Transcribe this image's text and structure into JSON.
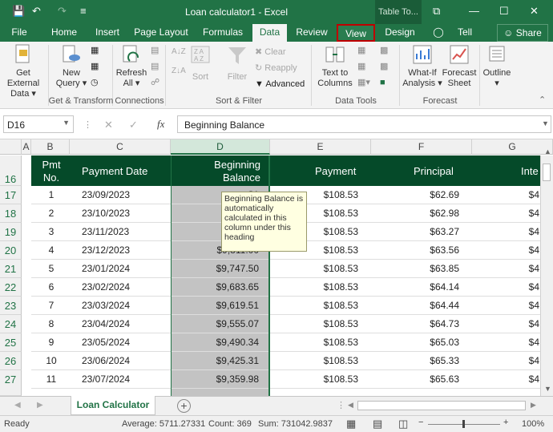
{
  "titlebar": {
    "save_icon": "💾",
    "undo_icon": "↶",
    "redo_icon": "↷",
    "more_icon": "≡",
    "title": "Loan calculator1 - Excel",
    "table_tools": "Table To...",
    "restore_icon": "⧉",
    "minimize_icon": "—",
    "maximize_icon": "☐",
    "close_icon": "✕"
  },
  "ribbon_tabs": [
    "File",
    "Home",
    "Insert",
    "Page Layout",
    "Formulas",
    "Data",
    "Review",
    "View",
    "Design"
  ],
  "active_tab": "Data",
  "tell_me": "Tell me...",
  "share": "Share",
  "ribbon": {
    "get_external_data": [
      "Get External",
      "Data ▾"
    ],
    "new_query": [
      "New",
      "Query ▾"
    ],
    "refresh_all": [
      "Refresh",
      "All ▾"
    ],
    "sort": "Sort",
    "filter": "Filter",
    "clear": "Clear",
    "reapply": "Reapply",
    "advanced": "Advanced",
    "text_to_columns": [
      "Text to",
      "Columns"
    ],
    "what_if": [
      "What-If",
      "Analysis ▾"
    ],
    "forecast_sheet": [
      "Forecast",
      "Sheet"
    ],
    "outline": [
      "Outline",
      "▾"
    ],
    "groups": [
      "Get & Transform",
      "Connections",
      "Sort & Filter",
      "Data Tools",
      "Forecast"
    ]
  },
  "formula_bar": {
    "name_box": "D16",
    "fx": "fx",
    "value": "Beginning Balance"
  },
  "columns": [
    "A",
    "B",
    "C",
    "D",
    "E",
    "F",
    "G"
  ],
  "rows": [
    "16",
    "17",
    "18",
    "19",
    "20",
    "21",
    "22",
    "23",
    "24",
    "25",
    "26",
    "27"
  ],
  "headers": {
    "pmt_no": [
      "Pmt",
      "No."
    ],
    "payment_date": "Payment Date",
    "beginning_balance": [
      "Beginning",
      "Balance"
    ],
    "payment": "Payment",
    "principal": "Principal",
    "interest": "Inte"
  },
  "table": [
    {
      "no": "1",
      "date": "23/09/2023",
      "balance": "$1",
      "payment": "$108.53",
      "principal": "$62.69",
      "interest": "$4"
    },
    {
      "no": "2",
      "date": "23/10/2023",
      "balance": "$",
      "payment": "$108.53",
      "principal": "$62.98",
      "interest": "$4"
    },
    {
      "no": "3",
      "date": "23/11/2023",
      "balance": "$",
      "payment": "$108.53",
      "principal": "$63.27",
      "interest": "$4"
    },
    {
      "no": "4",
      "date": "23/12/2023",
      "balance": "$9,811.00",
      "payment": "$108.53",
      "principal": "$63.56",
      "interest": "$4"
    },
    {
      "no": "5",
      "date": "23/01/2024",
      "balance": "$9,747.50",
      "payment": "$108.53",
      "principal": "$63.85",
      "interest": "$4"
    },
    {
      "no": "6",
      "date": "23/02/2024",
      "balance": "$9,683.65",
      "payment": "$108.53",
      "principal": "$64.14",
      "interest": "$4"
    },
    {
      "no": "7",
      "date": "23/03/2024",
      "balance": "$9,619.51",
      "payment": "$108.53",
      "principal": "$64.44",
      "interest": "$4"
    },
    {
      "no": "8",
      "date": "23/04/2024",
      "balance": "$9,555.07",
      "payment": "$108.53",
      "principal": "$64.73",
      "interest": "$4"
    },
    {
      "no": "9",
      "date": "23/05/2024",
      "balance": "$9,490.34",
      "payment": "$108.53",
      "principal": "$65.03",
      "interest": "$4"
    },
    {
      "no": "10",
      "date": "23/06/2024",
      "balance": "$9,425.31",
      "payment": "$108.53",
      "principal": "$65.33",
      "interest": "$4"
    },
    {
      "no": "11",
      "date": "23/07/2024",
      "balance": "$9,359.98",
      "payment": "$108.53",
      "principal": "$65.63",
      "interest": "$4"
    }
  ],
  "tooltip": "Beginning Balance is automatically calculated in this column under this heading",
  "sheet_tab": "Loan Calculator",
  "add_sheet": "+",
  "status": {
    "ready": "Ready",
    "average": "Average: 5711.27331",
    "count": "Count: 369",
    "sum": "Sum: 731042.9837",
    "zoom": "100%",
    "zoom_minus": "−",
    "zoom_plus": "+"
  },
  "colors": {
    "excel_green": "#217346",
    "header_green": "#054a29",
    "highlight_red": "#c00000"
  }
}
